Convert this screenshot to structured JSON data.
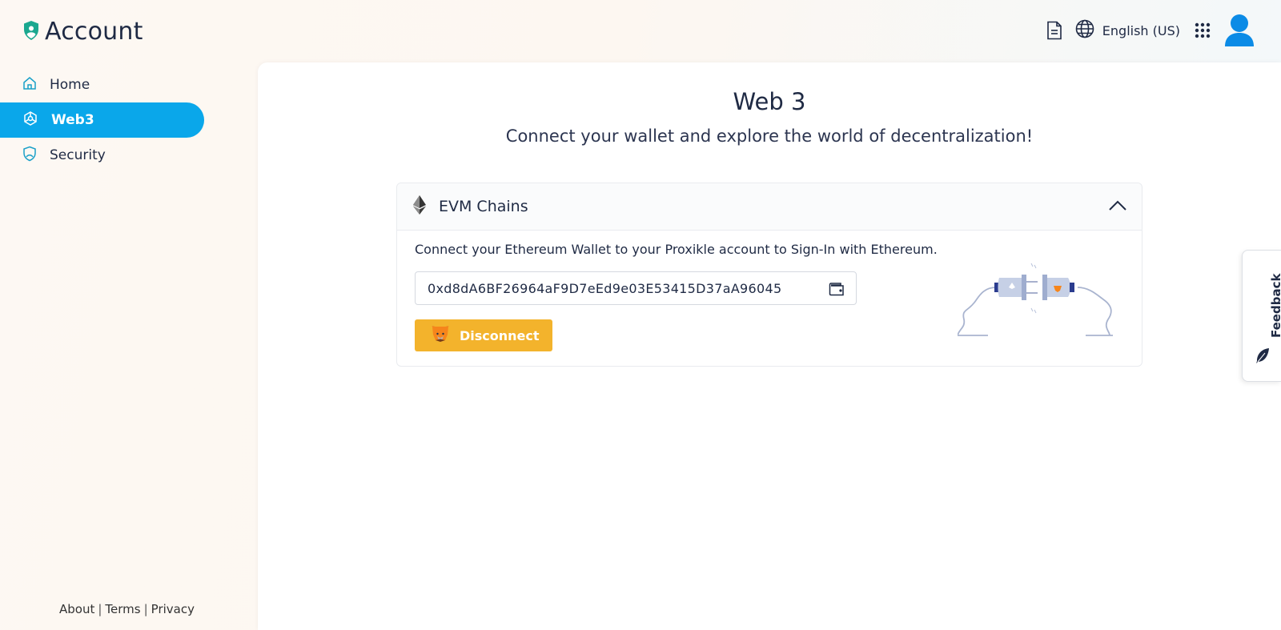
{
  "app": {
    "title": "Account"
  },
  "topbar": {
    "language": "English (US)"
  },
  "sidebar": {
    "items": [
      {
        "label": "Home",
        "active": false
      },
      {
        "label": "Web3",
        "active": true
      },
      {
        "label": "Security",
        "active": false
      }
    ]
  },
  "footer": {
    "about": "About",
    "terms": "Terms",
    "privacy": "Privacy",
    "separator": "|"
  },
  "main": {
    "title": "Web 3",
    "subtitle": "Connect your wallet and explore the world of decentralization!"
  },
  "card": {
    "title": "EVM Chains",
    "description": "Connect your Ethereum Wallet to your Proxikle account to Sign-In with Ethereum.",
    "address": "0xd8dA6BF26964aF9D7eEd9e03E53415D37aA96045",
    "disconnect_label": "Disconnect"
  },
  "feedback": {
    "label": "Feedback"
  },
  "colors": {
    "accent": "#0aa7ea",
    "button": "#f3b32c",
    "text": "#1f2a44",
    "brand": "#1aa88f"
  }
}
